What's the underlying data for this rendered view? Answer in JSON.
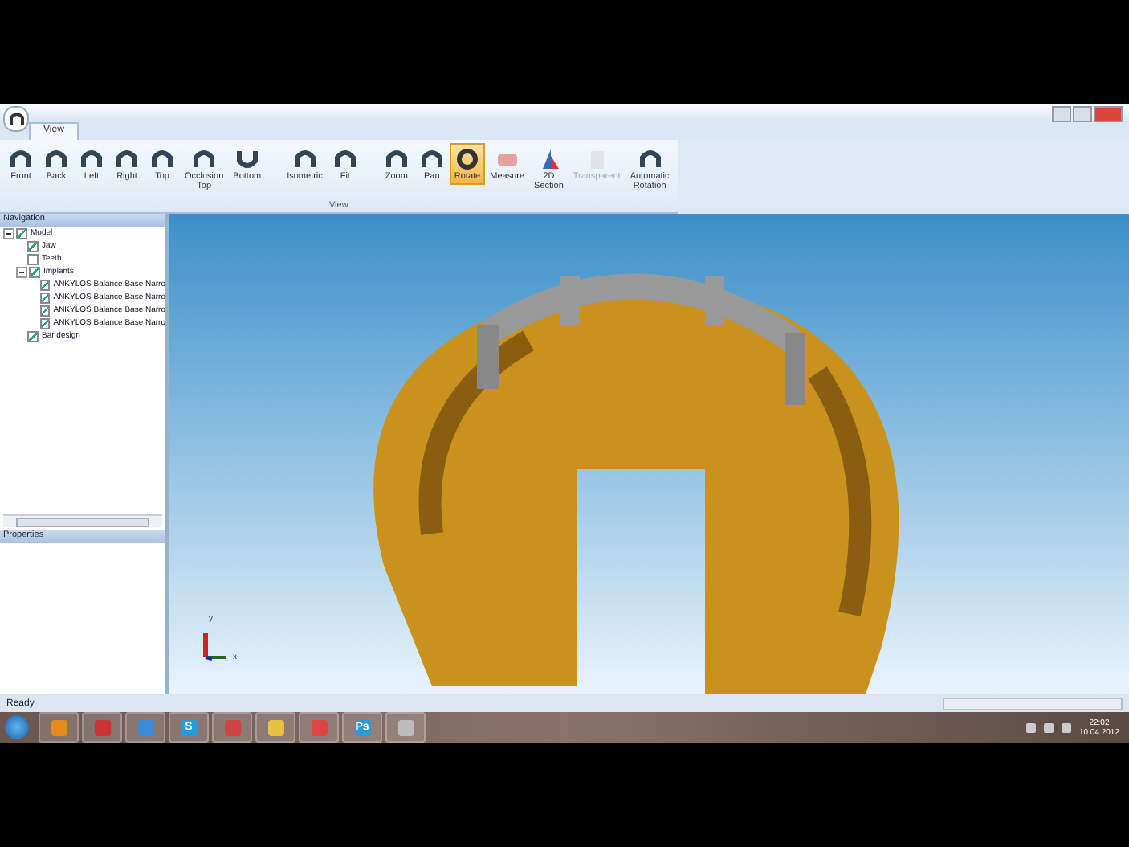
{
  "ribbon": {
    "tabs": [
      {
        "label": "View",
        "selected": true
      }
    ],
    "buttons": [
      {
        "label": "Front",
        "kind": "arch",
        "selected": false,
        "disabled": false
      },
      {
        "label": "Back",
        "kind": "arch",
        "selected": false,
        "disabled": false
      },
      {
        "label": "Left",
        "kind": "arch",
        "selected": false,
        "disabled": false
      },
      {
        "label": "Right",
        "kind": "arch",
        "selected": false,
        "disabled": false
      },
      {
        "label": "Top",
        "kind": "arch",
        "selected": false,
        "disabled": false
      },
      {
        "label": "Occlusion Top",
        "kind": "arch",
        "selected": false,
        "disabled": false
      },
      {
        "label": "Bottom",
        "kind": "bottom",
        "selected": false,
        "disabled": false
      },
      {
        "label": "Isometric",
        "kind": "arch",
        "selected": false,
        "disabled": false,
        "group_start": true
      },
      {
        "label": "Fit",
        "kind": "arch",
        "selected": false,
        "disabled": false
      },
      {
        "label": "Zoom",
        "kind": "arch",
        "selected": false,
        "disabled": false,
        "group_start": true
      },
      {
        "label": "Pan",
        "kind": "arch",
        "selected": false,
        "disabled": false
      },
      {
        "label": "Rotate",
        "kind": "rotate",
        "selected": true,
        "disabled": false
      },
      {
        "label": "Measure",
        "kind": "measure",
        "selected": false,
        "disabled": false
      },
      {
        "label": "2D Section",
        "kind": "section",
        "selected": false,
        "disabled": false
      },
      {
        "label": "Transparent",
        "kind": "transparent",
        "selected": false,
        "disabled": true
      },
      {
        "label": "Automatic Rotation",
        "kind": "arch",
        "selected": false,
        "disabled": false
      }
    ],
    "group_label": "View"
  },
  "navigation": {
    "title": "Navigation",
    "tree": [
      {
        "label": "Model",
        "checked": true,
        "expanded": true,
        "children": [
          {
            "label": "Jaw",
            "checked": true
          },
          {
            "label": "Teeth",
            "checked": false
          },
          {
            "label": "Implants",
            "checked": true,
            "expanded": true,
            "children": [
              {
                "label": "ANKYLOS Balance Base Narro",
                "checked": true
              },
              {
                "label": "ANKYLOS Balance Base Narro",
                "checked": true
              },
              {
                "label": "ANKYLOS Balance Base Narro",
                "checked": true
              },
              {
                "label": "ANKYLOS Balance Base Narro",
                "checked": true
              }
            ]
          },
          {
            "label": "Bar design",
            "checked": true
          }
        ]
      }
    ]
  },
  "properties": {
    "title": "Properties"
  },
  "viewport": {
    "axes": {
      "x": "x",
      "y": "y"
    }
  },
  "status_bar": {
    "text": "Ready"
  },
  "taskbar": {
    "items": [
      {
        "kind": "media"
      },
      {
        "kind": "paint"
      },
      {
        "kind": "browser"
      },
      {
        "kind": "letter",
        "label": "S"
      },
      {
        "kind": "office"
      },
      {
        "kind": "folder"
      },
      {
        "kind": "app"
      },
      {
        "kind": "letter",
        "label": "Ps"
      },
      {
        "kind": "arch"
      }
    ],
    "time": "22:02",
    "date": "10.04.2012"
  }
}
